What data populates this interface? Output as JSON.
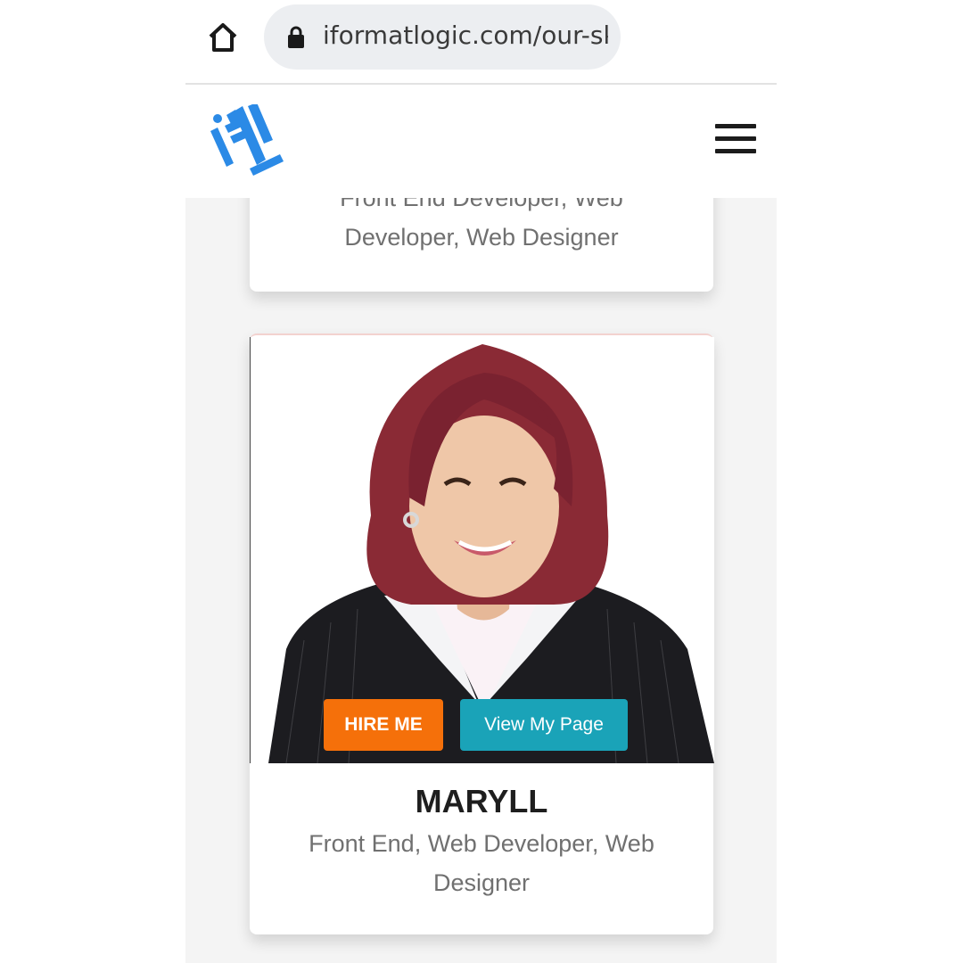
{
  "browser": {
    "url": "iformatlogic.com/our-ski"
  },
  "site": {
    "logo_text": "IFL"
  },
  "cards": [
    {
      "role_line_1": "Front End Developer, Web",
      "role_line_2": "Developer, Web Designer"
    },
    {
      "name": "MARYLL",
      "role_line_1": "Front End, Web Developer, Web",
      "role_line_2": "Designer",
      "hire_label": "HIRE ME",
      "view_label": "View My Page"
    }
  ],
  "colors": {
    "hire_button": "#f5700a",
    "view_button": "#1aa3b8",
    "logo_blue": "#2b8ae6"
  },
  "icons": {
    "home": "home-icon",
    "lock": "lock-icon",
    "menu": "hamburger-menu-icon"
  }
}
